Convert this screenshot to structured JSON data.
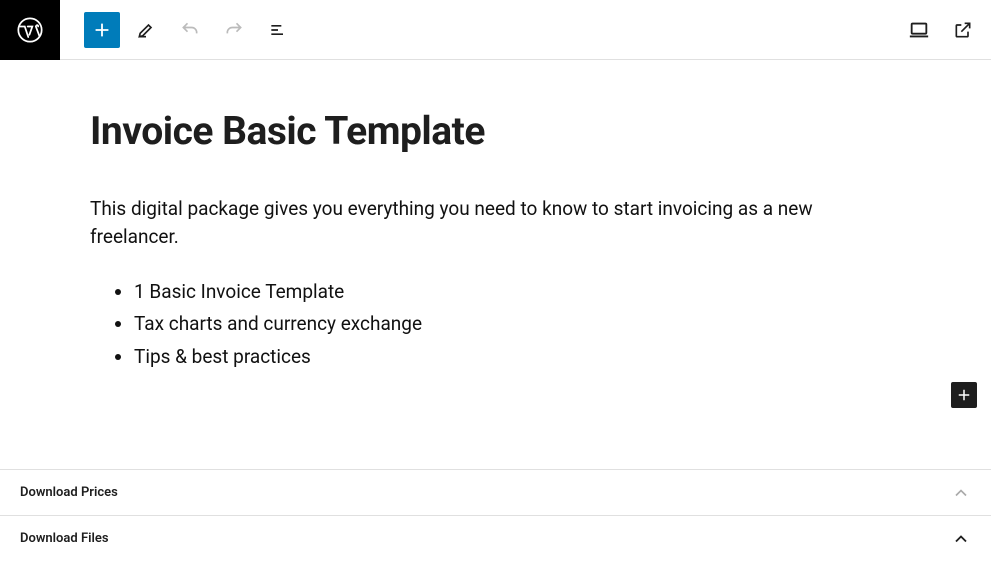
{
  "toolbar": {
    "wp_logo": "wordpress",
    "add_block": "add",
    "edit": "edit",
    "undo": "undo",
    "redo": "redo",
    "outline": "outline",
    "view_desktop": "desktop",
    "view_external": "external"
  },
  "post": {
    "title": "Invoice Basic Template",
    "intro": "This digital package gives you everything you need to know to start invoicing as a new freelancer.",
    "bullets": [
      "1 Basic Invoice Template",
      "Tax charts and currency exchange",
      "Tips & best practices"
    ]
  },
  "floating": {
    "add_block": "add"
  },
  "panels": {
    "prices": "Download Prices",
    "files": "Download Files"
  }
}
